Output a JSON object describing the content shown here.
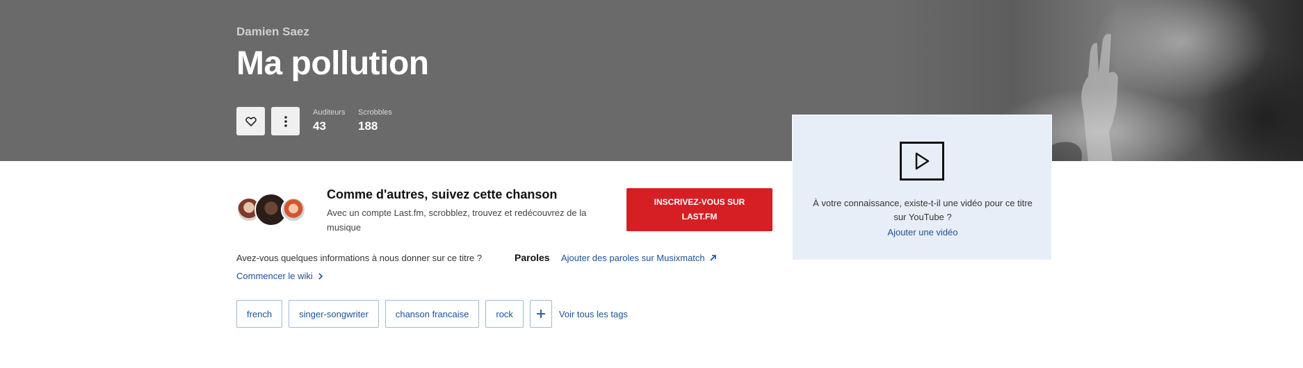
{
  "track": {
    "artist": "Damien Saez",
    "title": "Ma pollution",
    "stats": [
      {
        "label": "Auditeurs",
        "value": "43"
      },
      {
        "label": "Scrobbles",
        "value": "188"
      }
    ]
  },
  "video": {
    "question": "À votre connaissance, existe-t-il une vidéo pour ce titre sur YouTube ?",
    "add_link": "Ajouter une vidéo"
  },
  "promo": {
    "title": "Comme d'autres, suivez cette chanson",
    "subtitle": "Avec un compte Last.fm, scrobblez, trouvez et redécouvrez de la musique",
    "signup_label": "INSCRIVEZ-VOUS SUR LAST.FM"
  },
  "wiki": {
    "question": "Avez-vous quelques informations à nous donner sur ce titre ?",
    "start_link": "Commencer le wiki"
  },
  "lyrics": {
    "heading": "Paroles",
    "link": "Ajouter des paroles sur Musixmatch"
  },
  "tags": {
    "items": [
      "french",
      "singer-songwriter",
      "chanson francaise",
      "rock"
    ],
    "all_label": "Voir tous les tags"
  },
  "colors": {
    "accent_red": "#d51f24",
    "link_blue": "#1a5196",
    "hero_gray": "#6a6a6a",
    "video_bg": "#e8eef8"
  }
}
